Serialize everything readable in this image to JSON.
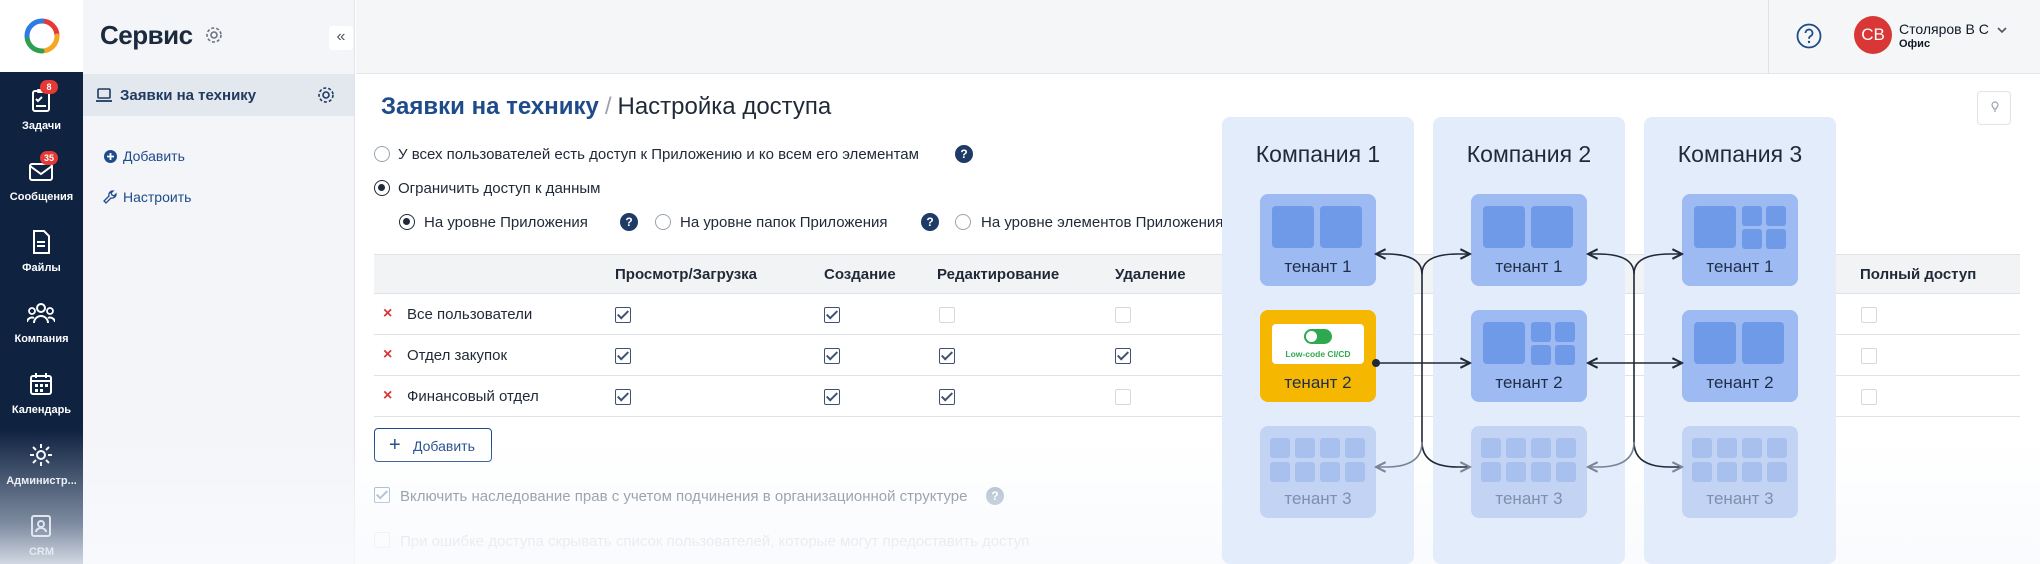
{
  "rail": {
    "items": [
      {
        "label": "Задачи",
        "badge": "8"
      },
      {
        "label": "Сообщения",
        "badge": "35"
      },
      {
        "label": "Файлы",
        "badge": ""
      },
      {
        "label": "Компания",
        "badge": ""
      },
      {
        "label": "Календарь",
        "badge": ""
      },
      {
        "label": "Администр...",
        "badge": ""
      },
      {
        "label": "CRM",
        "badge": ""
      }
    ]
  },
  "service": {
    "title": "Сервис",
    "collapse": "«",
    "active_item": "Заявки на технику",
    "links": [
      {
        "label": "Добавить",
        "icon": "plus-circle-icon"
      },
      {
        "label": "Настроить",
        "icon": "wrench-icon"
      }
    ]
  },
  "topbar": {
    "help": "?",
    "avatar": "СВ",
    "user_name": "Столяров В С",
    "user_sub": "Офис"
  },
  "breadcrumb": {
    "parent": "Заявки на технику",
    "separator": "/",
    "current": "Настройка доступа"
  },
  "access": {
    "option_all": "У всех пользователей есть доступ к Приложению и ко всем его элементам",
    "option_limited": "Ограничить доступ к данным",
    "levels": [
      "На уровне Приложения",
      "На уровне папок Приложения",
      "На уровне элементов Приложения"
    ],
    "question_mark": "?"
  },
  "table": {
    "headers": [
      "Просмотр/Загрузка",
      "Создание",
      "Редактирование",
      "Удаление",
      "Полный доступ"
    ],
    "rows": [
      {
        "name": "Все пользователи",
        "remove": "×",
        "perms": [
          true,
          true,
          false,
          false,
          false
        ]
      },
      {
        "name": "Отдел закупок",
        "remove": "×",
        "perms": [
          true,
          true,
          true,
          true,
          false
        ]
      },
      {
        "name": "Финансовый отдел",
        "remove": "×",
        "perms": [
          true,
          true,
          true,
          false,
          false
        ]
      }
    ]
  },
  "add_button": {
    "plus": "+",
    "label": "Добавить"
  },
  "inherit_label": "Включить наследование прав с учетом подчинения в организационной структуре",
  "error_label": "При ошибке доступа скрывать список пользователей, которые могут предоставить доступ",
  "diagram": {
    "companies": [
      "Компания 1",
      "Компания 2",
      "Компания 3"
    ],
    "tenants": [
      "тенант 1",
      "тенант 2",
      "тенант 3"
    ],
    "lowcode_label": "Low-code CI/CD"
  },
  "colors": {
    "rail": "#0f2240",
    "accent": "#1e4b8a",
    "danger": "#d93636",
    "tenant": "#9dbaf2",
    "tenant_highlight": "#f6b700",
    "company_bg": "#e3ecfb"
  }
}
